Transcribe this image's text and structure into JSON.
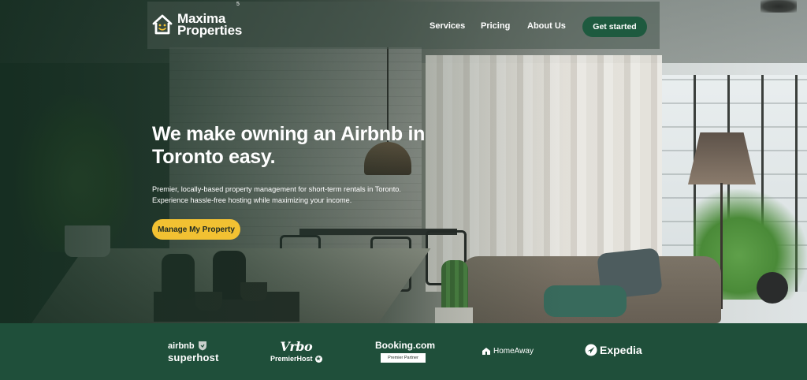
{
  "nav": {
    "brand_line1": "Maxima",
    "brand_line2": "Properties",
    "badge": "5",
    "links": [
      {
        "label": "Services"
      },
      {
        "label": "Pricing"
      },
      {
        "label": "About Us"
      }
    ],
    "cta_label": "Get started"
  },
  "hero": {
    "headline_line1": "We make owning an Airbnb in",
    "headline_line2": "Toronto easy.",
    "subtext_line1": "Premier, locally-based property management for short-term rentals in Toronto.",
    "subtext_line2": "Experience hassle-free hosting while maximizing your income.",
    "button_label": "Manage My Property"
  },
  "partners": {
    "airbnb_top": "airbnb",
    "airbnb_bottom": "superhost",
    "vrbo_top": "Vrbo",
    "vrbo_bottom": "PremierHost",
    "booking_top": "Booking.com",
    "booking_pill": "Premier Partner",
    "homeaway": "HomeAway",
    "expedia": "Expedia"
  },
  "colors": {
    "brand_green": "#1f4f3a",
    "cta_green": "#1e5a3f",
    "accent_yellow": "#f2c132"
  }
}
